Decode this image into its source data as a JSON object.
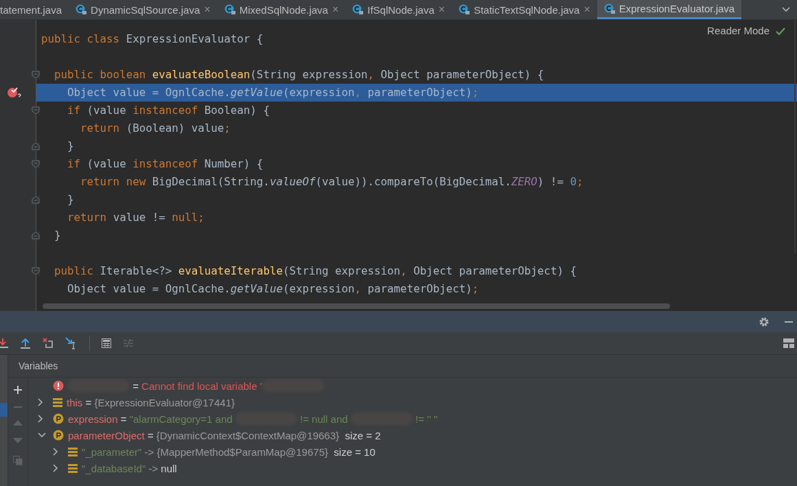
{
  "tabs": [
    {
      "label": "tatement.java",
      "selected": false,
      "kind": "cut"
    },
    {
      "label": "DynamicSqlSource.java",
      "selected": false,
      "kind": "class"
    },
    {
      "label": "MixedSqlNode.java",
      "selected": false,
      "kind": "class"
    },
    {
      "label": "IfSqlNode.java",
      "selected": false,
      "kind": "class"
    },
    {
      "label": "StaticTextSqlNode.java",
      "selected": false,
      "kind": "class"
    },
    {
      "label": "ExpressionEvaluator.java",
      "selected": true,
      "kind": "class"
    }
  ],
  "tab_close": "×",
  "editor": {
    "reader_mode": "Reader Mode",
    "lines": [
      {
        "kind": "code",
        "selected": false,
        "breakpoint": false,
        "fold_start": false,
        "fold_end": false,
        "tokens": [
          {
            "kind": "kw",
            "t": "public class "
          },
          {
            "kind": "plain",
            "t": "ExpressionEvaluator {"
          }
        ]
      },
      {
        "kind": "blank"
      },
      {
        "kind": "code",
        "selected": false,
        "breakpoint": false,
        "fold_start": true,
        "fold_end": false,
        "tokens": [
          {
            "kind": "kw",
            "t": "  public boolean "
          },
          {
            "kind": "fn",
            "t": "evaluateBoolean"
          },
          {
            "kind": "plain",
            "t": "(String expression"
          },
          {
            "kind": "kw",
            "t": ", "
          },
          {
            "kind": "plain",
            "t": "Object parameterObject) {"
          }
        ]
      },
      {
        "kind": "code",
        "selected": true,
        "breakpoint": true,
        "fold_start": false,
        "fold_end": false,
        "tokens": [
          {
            "kind": "plain",
            "t": "    Object value = OgnlCache."
          },
          {
            "kind": "italic",
            "t": "getValue"
          },
          {
            "kind": "plain",
            "t": "(expression"
          },
          {
            "kind": "kw",
            "t": ", "
          },
          {
            "kind": "plain",
            "t": "parameterObject)"
          },
          {
            "kind": "kw",
            "t": ";"
          }
        ]
      },
      {
        "kind": "code",
        "selected": false,
        "breakpoint": false,
        "fold_start": true,
        "fold_end": false,
        "tokens": [
          {
            "kind": "kw",
            "t": "    if "
          },
          {
            "kind": "plain",
            "t": "(value "
          },
          {
            "kind": "kw",
            "t": "instanceof "
          },
          {
            "kind": "plain",
            "t": "Boolean) {"
          }
        ]
      },
      {
        "kind": "code",
        "selected": false,
        "breakpoint": false,
        "fold_start": false,
        "fold_end": false,
        "tokens": [
          {
            "kind": "kw",
            "t": "      return "
          },
          {
            "kind": "plain",
            "t": "(Boolean) value"
          },
          {
            "kind": "kw",
            "t": ";"
          }
        ]
      },
      {
        "kind": "code",
        "selected": false,
        "breakpoint": false,
        "fold_start": false,
        "fold_end": true,
        "tokens": [
          {
            "kind": "plain",
            "t": "    }"
          }
        ]
      },
      {
        "kind": "code",
        "selected": false,
        "breakpoint": false,
        "fold_start": true,
        "fold_end": false,
        "tokens": [
          {
            "kind": "kw",
            "t": "    if "
          },
          {
            "kind": "plain",
            "t": "(value "
          },
          {
            "kind": "kw",
            "t": "instanceof "
          },
          {
            "kind": "plain",
            "t": "Number) {"
          }
        ]
      },
      {
        "kind": "code",
        "selected": false,
        "breakpoint": false,
        "fold_start": false,
        "fold_end": false,
        "tokens": [
          {
            "kind": "kw",
            "t": "      return new "
          },
          {
            "kind": "plain",
            "t": "BigDecimal(String."
          },
          {
            "kind": "italic",
            "t": "valueOf"
          },
          {
            "kind": "plain",
            "t": "(value)).compareTo(BigDecimal."
          },
          {
            "kind": "const",
            "t": "ZERO"
          },
          {
            "kind": "plain",
            "t": ") != "
          },
          {
            "kind": "num",
            "t": "0"
          },
          {
            "kind": "kw",
            "t": ";"
          }
        ]
      },
      {
        "kind": "code",
        "selected": false,
        "breakpoint": false,
        "fold_start": false,
        "fold_end": true,
        "tokens": [
          {
            "kind": "plain",
            "t": "    }"
          }
        ]
      },
      {
        "kind": "code",
        "selected": false,
        "breakpoint": false,
        "fold_start": false,
        "fold_end": false,
        "tokens": [
          {
            "kind": "kw",
            "t": "    return "
          },
          {
            "kind": "plain",
            "t": "value != "
          },
          {
            "kind": "kw",
            "t": "null;"
          }
        ]
      },
      {
        "kind": "code",
        "selected": false,
        "breakpoint": false,
        "fold_start": false,
        "fold_end": true,
        "tokens": [
          {
            "kind": "plain",
            "t": "  }"
          }
        ]
      },
      {
        "kind": "blank"
      },
      {
        "kind": "code",
        "selected": false,
        "breakpoint": false,
        "fold_start": true,
        "fold_end": false,
        "tokens": [
          {
            "kind": "kw",
            "t": "  public "
          },
          {
            "kind": "plain",
            "t": "Iterable<?> "
          },
          {
            "kind": "fn",
            "t": "evaluateIterable"
          },
          {
            "kind": "plain",
            "t": "(String expression"
          },
          {
            "kind": "kw",
            "t": ", "
          },
          {
            "kind": "plain",
            "t": "Object parameterObject) {"
          }
        ]
      },
      {
        "kind": "code",
        "selected": false,
        "breakpoint": false,
        "fold_start": false,
        "fold_end": false,
        "tokens": [
          {
            "kind": "plain",
            "t": "    Object value = OgnlCache."
          },
          {
            "kind": "italic",
            "t": "getValue"
          },
          {
            "kind": "plain",
            "t": "(expression"
          },
          {
            "kind": "kw",
            "t": ", "
          },
          {
            "kind": "plain",
            "t": "parameterObject)"
          },
          {
            "kind": "kw",
            "t": ";"
          }
        ]
      }
    ]
  },
  "variables": {
    "title": "Variables",
    "rows": [
      {
        "kind": "error",
        "tokens": [
          {
            "kind": "redacted"
          },
          {
            "kind": "op",
            "t": " = "
          },
          {
            "kind": "err",
            "t": "Cannot find local variable '"
          },
          {
            "kind": "redacted"
          }
        ]
      },
      {
        "kind": "field",
        "expanded": false,
        "tokens": [
          {
            "kind": "name",
            "t": "this"
          },
          {
            "kind": "op",
            "t": " = "
          },
          {
            "kind": "ref",
            "t": "{ExpressionEvaluator@17441}"
          }
        ]
      },
      {
        "kind": "param",
        "expanded": false,
        "tokens": [
          {
            "kind": "name",
            "t": "expression"
          },
          {
            "kind": "op",
            "t": " = "
          },
          {
            "kind": "str",
            "t": "\"alarmCategory=1 and "
          },
          {
            "kind": "redacted"
          },
          {
            "kind": "str",
            "t": " != null and "
          },
          {
            "kind": "redacted"
          },
          {
            "kind": "str",
            "t": " != '' \""
          }
        ]
      },
      {
        "kind": "param",
        "expanded": true,
        "tokens": [
          {
            "kind": "name",
            "t": "parameterObject"
          },
          {
            "kind": "op",
            "t": " = "
          },
          {
            "kind": "ref",
            "t": "{DynamicContext$ContextMap@19663}"
          },
          {
            "kind": "op",
            "t": "  size = 2"
          }
        ],
        "children": [
          {
            "kind": "field",
            "expanded": false,
            "tokens": [
              {
                "kind": "str",
                "t": "\"_parameter\""
              },
              {
                "kind": "ref",
                "t": " -> {MapperMethod$ParamMap@19675}"
              },
              {
                "kind": "op",
                "t": "  size = 10"
              }
            ]
          },
          {
            "kind": "field",
            "expanded": false,
            "tokens": [
              {
                "kind": "str",
                "t": "\"_databaseId\""
              },
              {
                "kind": "ref",
                "t": " -> "
              },
              {
                "kind": "op",
                "t": "null"
              }
            ]
          }
        ]
      }
    ]
  }
}
